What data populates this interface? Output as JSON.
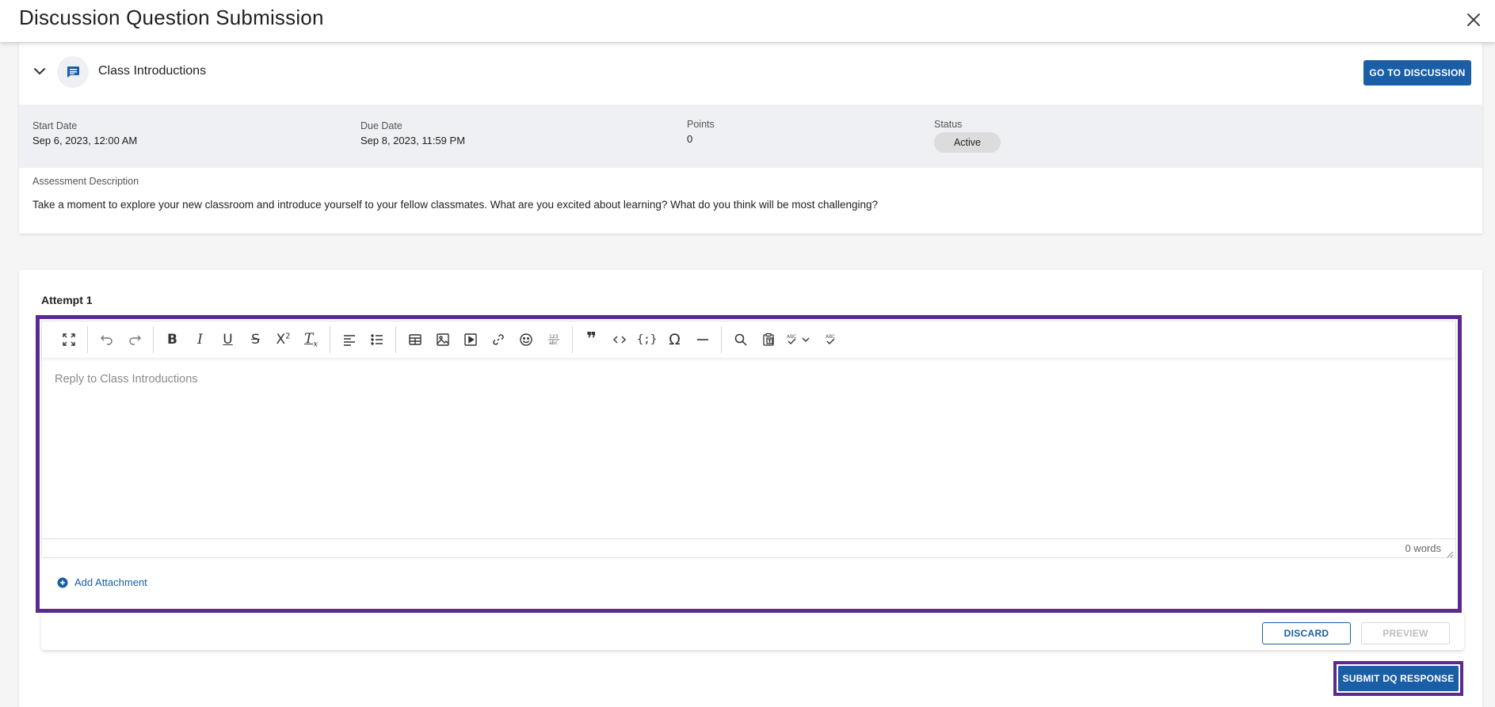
{
  "header": {
    "title": "Discussion Question Submission"
  },
  "discussion": {
    "topic_title": "Class Introductions",
    "go_to_button": "GO TO DISCUSSION",
    "meta": {
      "start_date_label": "Start Date",
      "start_date_value": "Sep 6, 2023, 12:00 AM",
      "due_date_label": "Due Date",
      "due_date_value": "Sep 8, 2023, 11:59 PM",
      "points_label": "Points",
      "points_value": "0",
      "status_label": "Status",
      "status_value": "Active"
    },
    "description_label": "Assessment Description",
    "description_text": "Take a moment to explore your new classroom and introduce yourself to your fellow classmates. What are you excited about learning? What do you think will be most challenging?"
  },
  "attempt": {
    "label": "Attempt 1",
    "editor": {
      "placeholder": "Reply to Class Introductions",
      "word_count": "0 words",
      "toolbar_icons": [
        "fullscreen-icon",
        "undo-icon",
        "redo-icon",
        "bold-icon",
        "italic-icon",
        "underline-icon",
        "strikethrough-icon",
        "superscript-icon",
        "clear-formatting-icon",
        "align-left-icon",
        "bullet-list-icon",
        "table-icon",
        "image-icon",
        "media-icon",
        "link-icon",
        "emoji-icon",
        "number-format-icon",
        "blockquote-icon",
        "code-icon",
        "code-sample-icon",
        "special-character-icon",
        "horizontal-rule-icon",
        "search-replace-icon",
        "paste-text-icon",
        "spellcheck-icon",
        "spellcheck-dropdown-icon",
        "spellcheck-dialog-icon"
      ]
    },
    "add_attachment": "Add Attachment",
    "discard_button": "DISCARD",
    "preview_button": "PREVIEW",
    "submit_button": "SUBMIT DQ RESPONSE"
  },
  "colors": {
    "primary": "#1a5ea7",
    "highlight_outline": "#5b2a91",
    "status_pill": "#dcdcdc"
  }
}
